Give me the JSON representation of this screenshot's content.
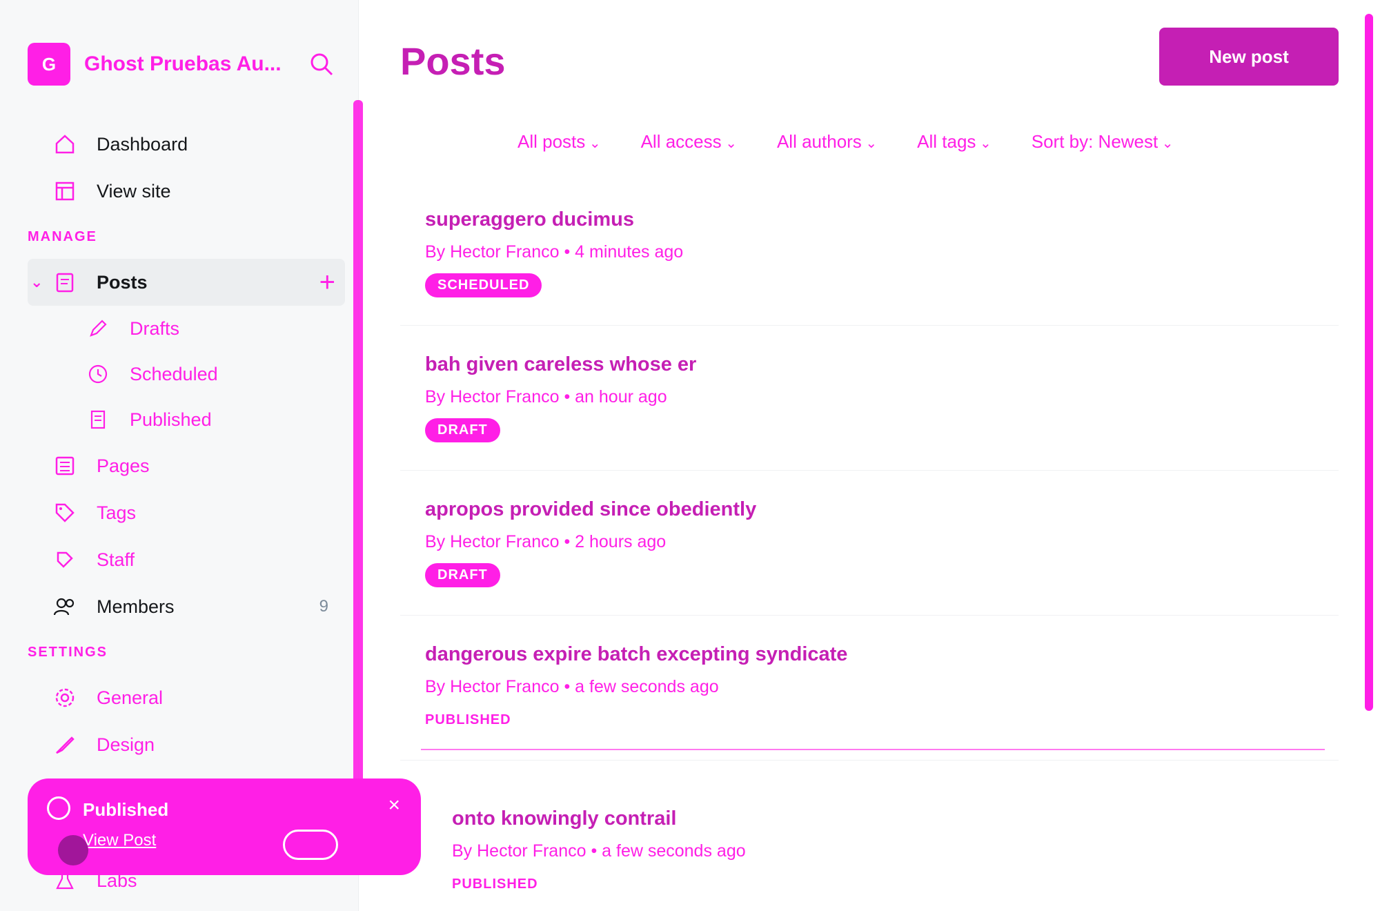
{
  "sidebar": {
    "site_initials": "G",
    "site_title": "Ghost Pruebas Au...",
    "manage_label": "MANAGE",
    "settings_label": "SETTINGS",
    "items": {
      "dashboard": "Dashboard",
      "view_site": "View site",
      "posts": "Posts",
      "drafts": "Drafts",
      "scheduled": "Scheduled",
      "published": "Published",
      "pages": "Pages",
      "tags": "Tags",
      "staff": "Staff",
      "members": "Members",
      "members_count": "9",
      "general": "General",
      "design": "Design",
      "labs": "Labs"
    }
  },
  "toast": {
    "title": "Published",
    "link": "View Post",
    "close": "×"
  },
  "header": {
    "title": "Posts",
    "new_post": "New post"
  },
  "filters": [
    "All posts",
    "All access",
    "All authors",
    "All tags",
    "Sort by: Newest"
  ],
  "posts": [
    {
      "title": "superaggero ducimus",
      "meta": "By Hector Franco • 4 minutes ago",
      "status": "SCHEDULED",
      "pill": true
    },
    {
      "title": "bah given careless whose er",
      "meta": "By Hector Franco • an hour ago",
      "status": "DRAFT",
      "pill": true
    },
    {
      "title": "apropos provided since obediently",
      "meta": "By Hector Franco • 2 hours ago",
      "status": "DRAFT",
      "pill": true
    },
    {
      "title": "dangerous expire batch excepting syndicate",
      "meta": "By Hector Franco • a few seconds ago",
      "status": "PUBLISHED",
      "pill": false
    }
  ],
  "extra_post": {
    "title": "onto knowingly contrail",
    "meta": "By Hector Franco • a few seconds ago",
    "status": "PUBLISHED"
  },
  "colors": {
    "accent": "#ff1fe6",
    "accent_dark": "#c51fb4"
  }
}
